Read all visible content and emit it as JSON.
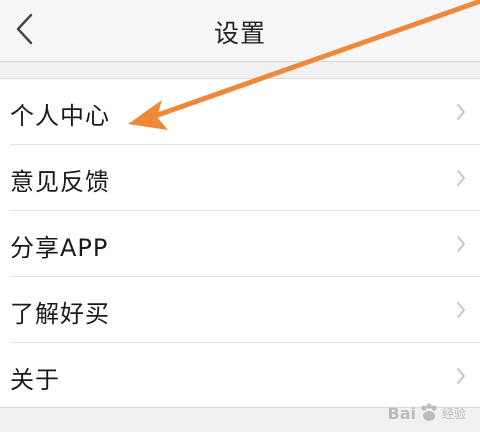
{
  "navbar": {
    "title": "设置",
    "back_icon": "chevron-left-icon"
  },
  "settings": {
    "items": [
      {
        "label": "个人中心"
      },
      {
        "label": "意见反馈"
      },
      {
        "label": "分享APP"
      },
      {
        "label": "了解好买"
      },
      {
        "label": "关于"
      }
    ]
  },
  "annotation": {
    "color": "#f0883a"
  },
  "watermark": {
    "brand": "Bai",
    "suffix": "经验"
  },
  "colors": {
    "background": "#f1f1f4",
    "list_background": "#ffffff",
    "chevron": "#c7c7cc",
    "text": "#1a1a1a"
  }
}
